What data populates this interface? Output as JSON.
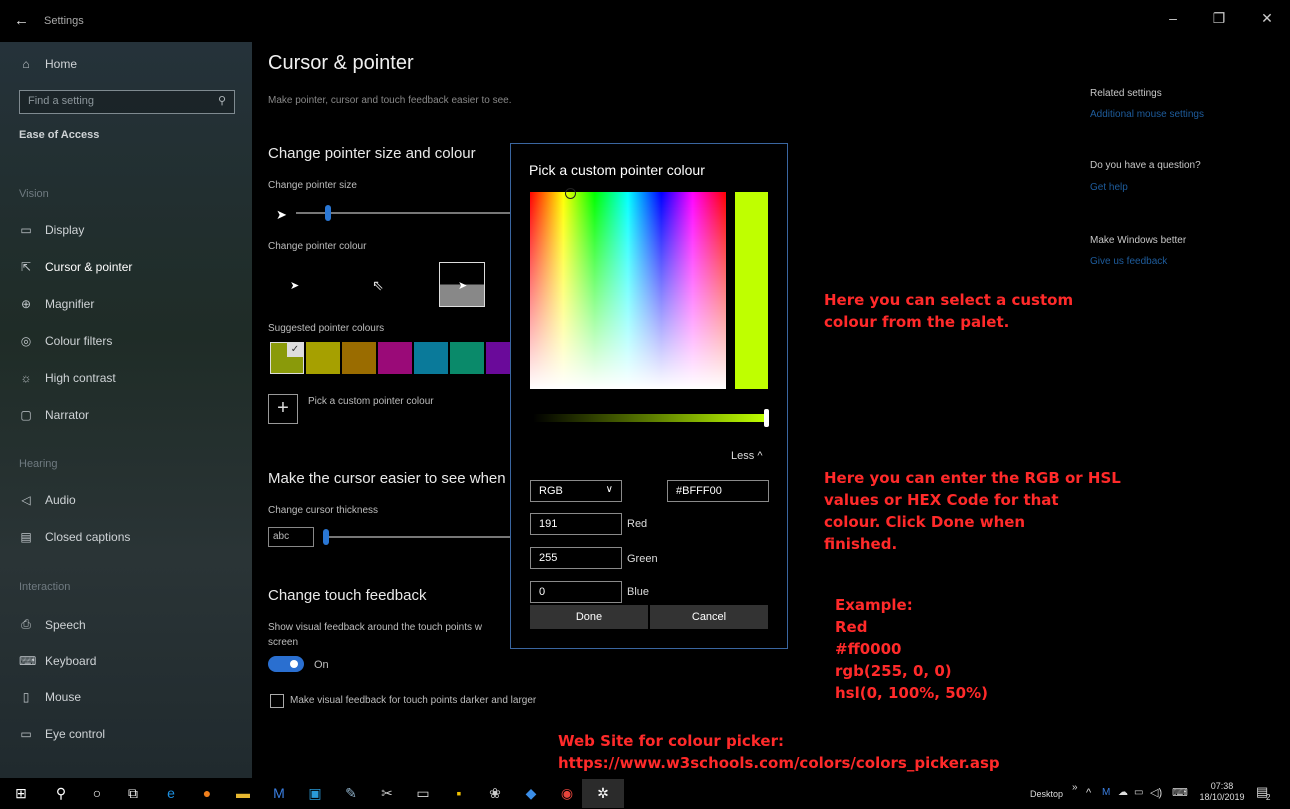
{
  "window": {
    "back_icon": "back-arrow-icon",
    "title": "Settings",
    "controls": [
      "–",
      "❐",
      "✕"
    ]
  },
  "sidebar": {
    "home": "Home",
    "search_placeholder": "Find a setting",
    "category": "Ease of Access",
    "groups": {
      "vision": "Vision",
      "hearing": "Hearing",
      "interaction": "Interaction"
    },
    "items": {
      "display": "Display",
      "cursor": "Cursor & pointer",
      "magnifier": "Magnifier",
      "colour_filters": "Colour filters",
      "high_contrast": "High contrast",
      "narrator": "Narrator",
      "audio": "Audio",
      "closed_captions": "Closed captions",
      "speech": "Speech",
      "keyboard": "Keyboard",
      "mouse": "Mouse",
      "eye_control": "Eye control"
    }
  },
  "main": {
    "title": "Cursor & pointer",
    "subtitle": "Make pointer, cursor and touch feedback easier to see.",
    "section_pointer": "Change pointer size and colour",
    "pointer_size_label": "Change pointer size",
    "pointer_colour_label": "Change pointer colour",
    "suggested_label": "Suggested pointer colours",
    "suggested_colours": [
      "#8a9a0a",
      "#a6a000",
      "#9a6c00",
      "#9a0a78",
      "#0a7a9a",
      "#0a8a6a",
      "#6a0a9a"
    ],
    "custom_colour": "Pick a custom pointer colour",
    "section_cursor": "Make the cursor easier to see when",
    "cursor_thickness_label": "Change cursor thickness",
    "cursor_preview": "abc",
    "section_touch": "Change touch feedback",
    "touch_desc_line1": "Show visual feedback around the touch points w",
    "touch_desc_line2": "screen",
    "toggle_state": "On",
    "darker_checkbox": "Make visual feedback for touch points darker and larger"
  },
  "related": {
    "heading": "Related settings",
    "mouse_link": "Additional mouse settings",
    "question": "Do you have a question?",
    "help_link": "Get help",
    "better": "Make Windows better",
    "feedback_link": "Give us feedback"
  },
  "dialog": {
    "title": "Pick a custom pointer colour",
    "selected_colour": "#BFFF00",
    "less": "Less",
    "mode": "RGB",
    "hex": "#BFFF00",
    "red_value": "191",
    "red_label": "Red",
    "green_value": "255",
    "green_label": "Green",
    "blue_value": "0",
    "blue_label": "Blue",
    "done": "Done",
    "cancel": "Cancel"
  },
  "annotations": {
    "palette_line1": "Here you can select a custom",
    "palette_line2": "colour from the palet.",
    "rgb_line1": "Here you can enter the RGB or HSL",
    "rgb_line2": "values or HEX Code for that",
    "rgb_line3": "colour.  Click Done when",
    "rgb_line4": "finished.",
    "example_title": "Example:",
    "example_name": "Red",
    "example_hex": "#ff0000",
    "example_rgb": "rgb(255, 0, 0)",
    "example_hsl": "hsl(0, 100%, 50%)",
    "website_title": "Web Site for colour picker:",
    "website_url": "https://www.w3schools.com/colors/colors_picker.asp"
  },
  "taskbar": {
    "desktop": "Desktop",
    "time": "07:38",
    "date": "18/10/2019",
    "notification_count": "2"
  }
}
